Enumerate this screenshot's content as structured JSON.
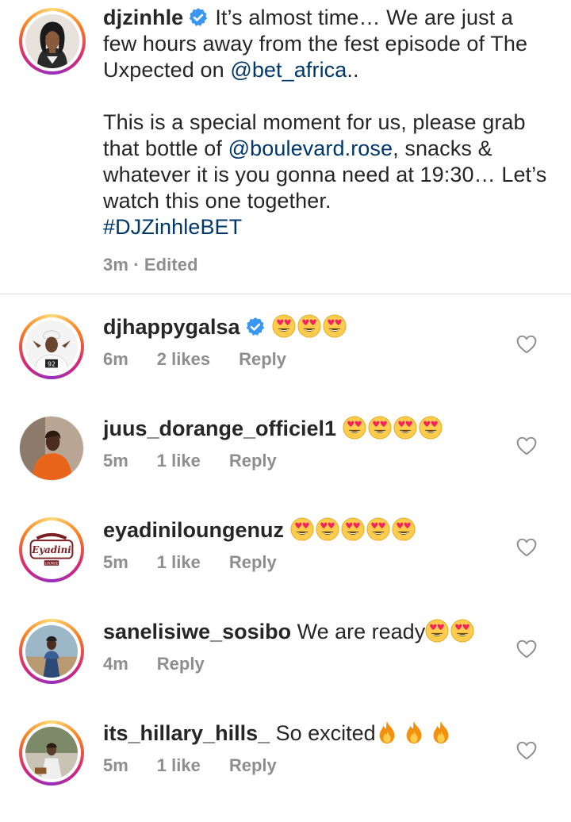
{
  "caption": {
    "username": "djzinhle",
    "line1": "It’s almost time… We are just a few hours away from the fest episode of The Uxpected on ",
    "mention1": "@bet_africa",
    "line1_end": "..",
    "line2_start": "This is a special moment for us, please grab that bottle of ",
    "mention2": "@boulevard.rose",
    "line2_end": ", snacks & whatever it is you gonna need at 19:30… Let’s watch this one together.",
    "hashtag": "#DJZinhleBET",
    "time": "3m",
    "separator": " · ",
    "edited": "Edited"
  },
  "comments": [
    {
      "username": "djhappygalsa",
      "verified": true,
      "text": "",
      "emoji": "heart-eyes",
      "emoji_count": 3,
      "time": "6m",
      "likes": "2 likes",
      "reply": "Reply"
    },
    {
      "username": "juus_dorange_officiel1",
      "verified": false,
      "text": "",
      "emoji": "heart-eyes",
      "emoji_count": 4,
      "time": "5m",
      "likes": "1 like",
      "reply": "Reply"
    },
    {
      "username": "eyadiniloungenuz",
      "verified": false,
      "text": "",
      "emoji": "heart-eyes",
      "emoji_count": 5,
      "time": "5m",
      "likes": "1 like",
      "reply": "Reply"
    },
    {
      "username": "sanelisiwe_sosibo",
      "verified": false,
      "text": "We are ready",
      "emoji": "heart-eyes",
      "emoji_count": 2,
      "time": "4m",
      "likes": "",
      "reply": "Reply"
    },
    {
      "username": "its_hillary_hills_",
      "verified": false,
      "text": "So excited",
      "emoji": "fire",
      "emoji_count": 3,
      "time": "5m",
      "likes": "1 like",
      "reply": "Reply"
    }
  ],
  "avatar_labels": {
    "eyadini_logo_text": "Eyadini",
    "eyadini_sub": "LOUNGE"
  },
  "colors": {
    "text": "#262626",
    "secondary": "#8e8e8e",
    "link": "#00376b",
    "verified": "#3897f0",
    "divider": "#dbdbdb"
  }
}
